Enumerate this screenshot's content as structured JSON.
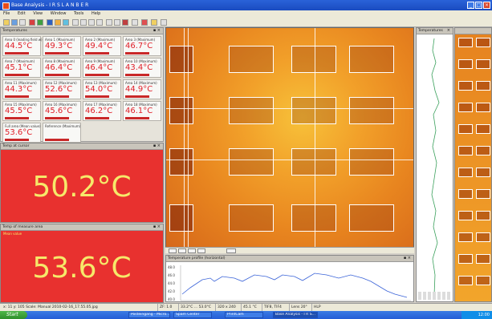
{
  "window": {
    "title": "Base Analysis - I R S L A N B E R"
  },
  "menu": [
    "File",
    "Edit",
    "View",
    "Window",
    "Tools",
    "Help"
  ],
  "temperatures": {
    "title": "Temperatures",
    "cells": [
      {
        "label": "Area 0 (leading field w)",
        "value": "44.5°C"
      },
      {
        "label": "Area 1 (Maximum)",
        "value": "49.3°C"
      },
      {
        "label": "Area 2 (Maximum)",
        "value": "49.4°C"
      },
      {
        "label": "Area 3 (Maximum)",
        "value": "46.7°C"
      },
      {
        "label": "Area 7 (Maximum)",
        "value": "45.1°C"
      },
      {
        "label": "Area 8 (Maximum)",
        "value": "46.4°C"
      },
      {
        "label": "Area 9 (Maximum)",
        "value": "46.4°C"
      },
      {
        "label": "Area 10 (Maximum)",
        "value": "43.4°C"
      },
      {
        "label": "Area 11 (Maximum)",
        "value": "44.3°C"
      },
      {
        "label": "Area 12 (Maximum)",
        "value": "52.6°C"
      },
      {
        "label": "Area 13 (Maximum)",
        "value": "54.0°C"
      },
      {
        "label": "Area 14 (Maximum)",
        "value": "44.9°C"
      },
      {
        "label": "Area 15 (Maximum)",
        "value": "45.5°C"
      },
      {
        "label": "Area 16 (Maximum)",
        "value": "45.6°C"
      },
      {
        "label": "Area 17 (Maximum)",
        "value": "46.2°C"
      },
      {
        "label": "Area 18 (Maximum)",
        "value": "46.1°C"
      },
      {
        "label": "Full area (Mean value)",
        "value": "53.6°C"
      },
      {
        "label": "Reference (Maximum)",
        "value": ""
      }
    ]
  },
  "pane1": {
    "title": "Temp at cursor",
    "value": "50.2°C"
  },
  "pane2": {
    "title": "Temp of measure area",
    "subtitle": "Mean value",
    "value": "53.6°C"
  },
  "profile": {
    "title": "Temperature profile (horizontal)",
    "ylabels": [
      "48.0",
      "46.0",
      "44.0",
      "42.0",
      "40.0"
    ]
  },
  "vprofile": {
    "title": "Temperatures"
  },
  "statusbar": [
    "x: 11 y: 105   Scale: Manual   2010-02-16_17.55.05.jpg",
    "ZF: 1.0",
    "33.2°C ... 53.0°C",
    "320 x 240",
    "45.1 °C",
    "TIF8, TIF4",
    "Lens 20°",
    "HLP"
  ],
  "taskbar": {
    "start": "Start",
    "tasks": [
      "Posteingang - Micro...",
      "Spam Center",
      "PrintCam",
      "Base Analysis - I R S..."
    ],
    "clock": "12:00"
  },
  "colors": {
    "alarm": "#e8312f",
    "value_text": "#f6e96a",
    "cell_value": "#e0202a"
  }
}
